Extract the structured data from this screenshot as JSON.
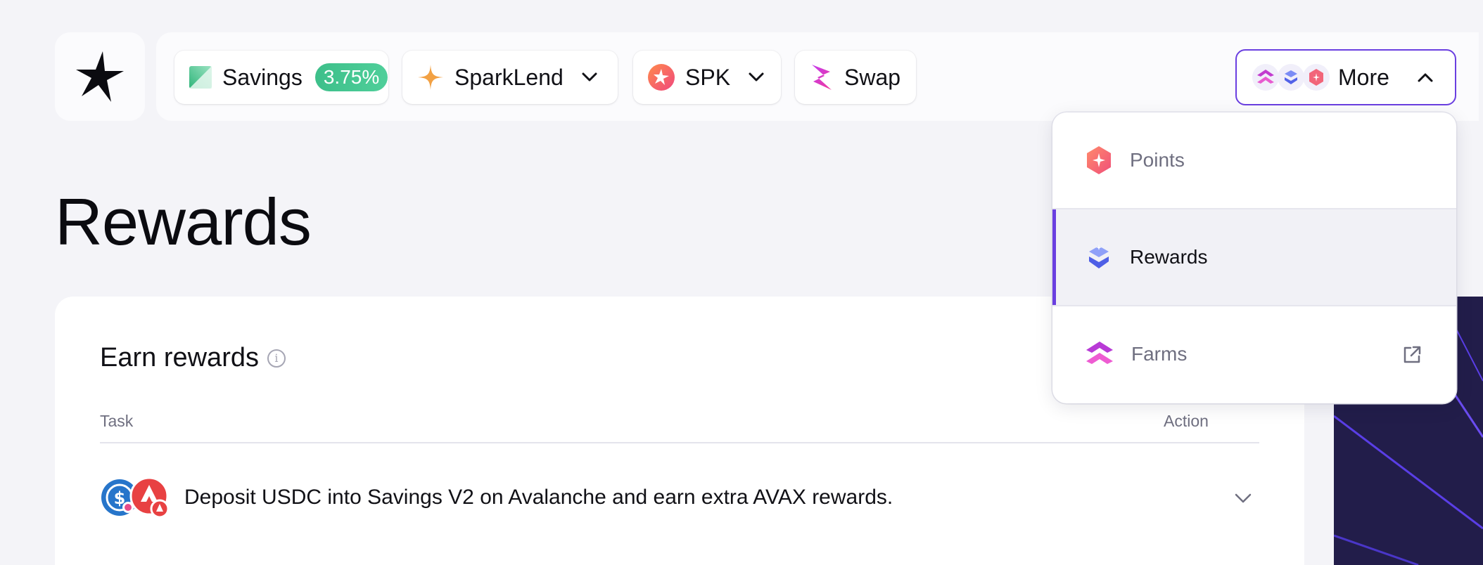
{
  "nav": {
    "savings": {
      "label": "Savings",
      "rate": "3.75%",
      "icon": "savings-icon"
    },
    "sparklend": {
      "label": "SparkLend",
      "icon": "sparklend-icon"
    },
    "spk": {
      "label": "SPK",
      "icon": "spk-icon"
    },
    "swap": {
      "label": "Swap",
      "icon": "swap-icon"
    },
    "more": {
      "label": "More",
      "icons": [
        "farms-icon",
        "rewards-icon",
        "points-icon"
      ]
    }
  },
  "dropdown": {
    "items": [
      {
        "label": "Points",
        "icon": "points-icon",
        "active": false
      },
      {
        "label": "Rewards",
        "icon": "rewards-icon",
        "active": true
      },
      {
        "label": "Farms",
        "icon": "farms-icon",
        "active": false,
        "external": true
      }
    ]
  },
  "page": {
    "title": "Rewards"
  },
  "card": {
    "title": "Earn rewards",
    "columns": {
      "task": "Task",
      "action": "Action"
    },
    "tasks": [
      {
        "text": "Deposit USDC into Savings V2 on Avalanche and earn extra AVAX rewards.",
        "icons": [
          "usdc-icon",
          "avax-icon"
        ]
      }
    ]
  },
  "colors": {
    "accent": "#6a3fe0",
    "savings_pill": "#3ec28d",
    "background": "#f4f4f8",
    "dark_panel": "#221d4a"
  }
}
